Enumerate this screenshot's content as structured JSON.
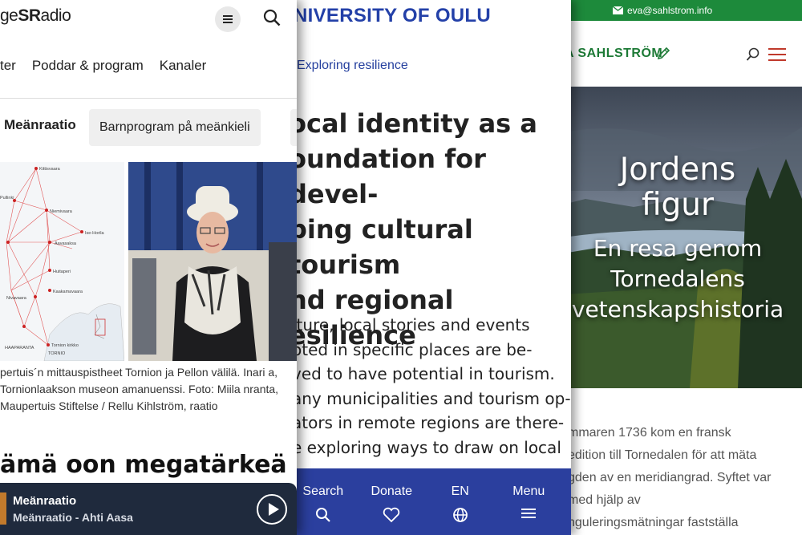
{
  "sr_page": {
    "logo_prefix": "ge",
    "logo_mark": "SR",
    "logo_suffix": "adio",
    "nav_items": [
      "ter",
      "Poddar & program",
      "Kanaler"
    ],
    "chips": [
      "Meänraatio",
      "Barnprogram på meänkieli"
    ],
    "map_labels": [
      "Kittisvaara",
      "Pullinki",
      "Niemivaara",
      "Ise-Horila",
      "Aavasaksa",
      "Huitaperi",
      "Kaakamavaara",
      "Nivavaara",
      "Tornion kirkko",
      "HAAPARANTA",
      "TORNIO"
    ],
    "caption": "pertuis´n mittauspistheet Tornion ja Pellon välilä. Inari a, Tornionlaakson museon amanuenssi. Foto: Miila nranta, Maupertuis Stiftelse / Rellu Kihlström, raatio",
    "headline": "ämä oon megatärkeä",
    "player": {
      "title": "Meänraatio",
      "subtitle": "Meänraatio - Ahti Aasa"
    }
  },
  "oulu_page": {
    "logo": "NIVERSITY OF OULU",
    "breadcrumb": "Exploring resilience",
    "title": "ocal identity as a oundation for devel- ping cultural tourism nd regional esilience",
    "title_lines": [
      "ocal identity as a",
      "oundation for devel-",
      "ping cultural tourism",
      "nd regional",
      "esilience"
    ],
    "body_lines": [
      "lture, local stories and events",
      "oted in specific places are be-",
      "ved to have potential in tourism.",
      "any municipalities and tourism op-",
      "ators in remote regions are there-",
      "e exploring ways to draw on local"
    ],
    "bottom_nav": [
      {
        "label": "Search",
        "icon": "search-icon"
      },
      {
        "label": "Donate",
        "icon": "heart-icon"
      },
      {
        "label": "EN",
        "icon": "globe-icon"
      },
      {
        "label": "Menu",
        "icon": "hamburger-icon"
      }
    ]
  },
  "sahlstrom_page": {
    "email": "eva@sahlstrom.info",
    "logo": "A SAHLSTRÖM",
    "hero_title_lines": [
      "Jordens",
      "figur"
    ],
    "hero_sub_lines": [
      "En resa genom",
      "Tornedalens",
      "vetenskapshistoria"
    ],
    "body_lines": [
      "mmaren 1736 kom en fransk",
      "edition till Tornedalen för att mäta",
      "gden av en meridiangrad. Syftet var",
      "med hjälp av",
      "nguleringsmätningar fastställa"
    ],
    "colors": {
      "green": "#1d8a3b",
      "accent_red": "#c0392b"
    }
  },
  "colors": {
    "oulu_blue": "#2b3f9e",
    "sr_player": "#1f2a3d"
  }
}
